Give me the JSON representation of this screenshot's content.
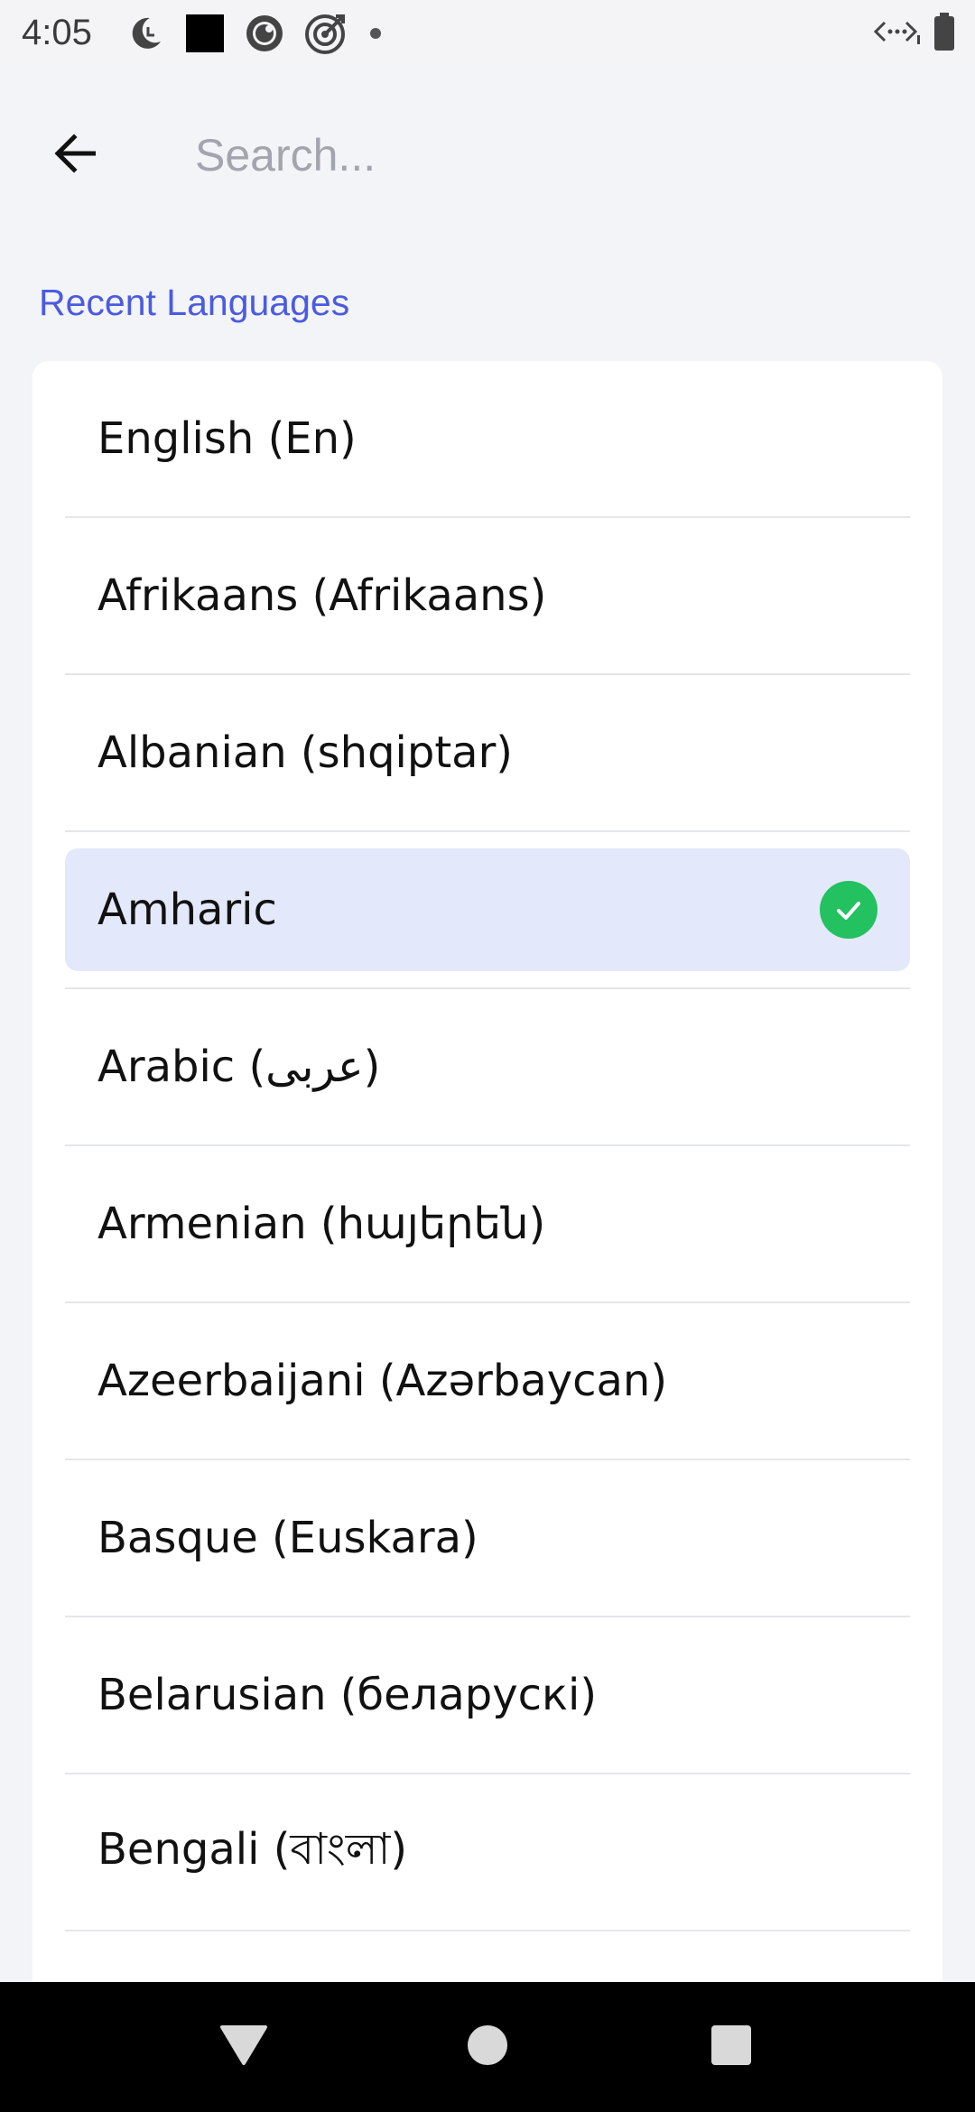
{
  "status_bar": {
    "time": "4:05",
    "left_icons": [
      "moon-clock-icon",
      "square-icon",
      "record-icon",
      "target-icon",
      "dot-icon"
    ],
    "right_icons": [
      "signal-arrows-icon",
      "battery-icon"
    ]
  },
  "header": {
    "back_icon": "arrow-left-icon",
    "search_placeholder": "Search...",
    "search_value": ""
  },
  "section": {
    "title": "Recent Languages"
  },
  "languages": [
    {
      "label": "English (En)",
      "selected": false
    },
    {
      "label": "Afrikaans (Afrikaans)",
      "selected": false
    },
    {
      "label": "Albanian (shqiptar)",
      "selected": false
    },
    {
      "label": "Amharic",
      "selected": true
    },
    {
      "label": "Arabic (عربى)",
      "selected": false
    },
    {
      "label": "Armenian (հայերեն)",
      "selected": false
    },
    {
      "label": "Azeerbaijani (Azərbaycan)",
      "selected": false
    },
    {
      "label": "Basque (Euskara)",
      "selected": false
    },
    {
      "label": "Belarusian (беларускі)",
      "selected": false
    },
    {
      "label": "Bengali (বাংলা)",
      "selected": false
    }
  ],
  "colors": {
    "accent": "#4b5be0",
    "selected_bg": "#e3e8fb",
    "check": "#23c15f"
  },
  "navbar": {
    "icons": [
      "back-triangle-icon",
      "home-circle-icon",
      "recents-square-icon"
    ]
  }
}
